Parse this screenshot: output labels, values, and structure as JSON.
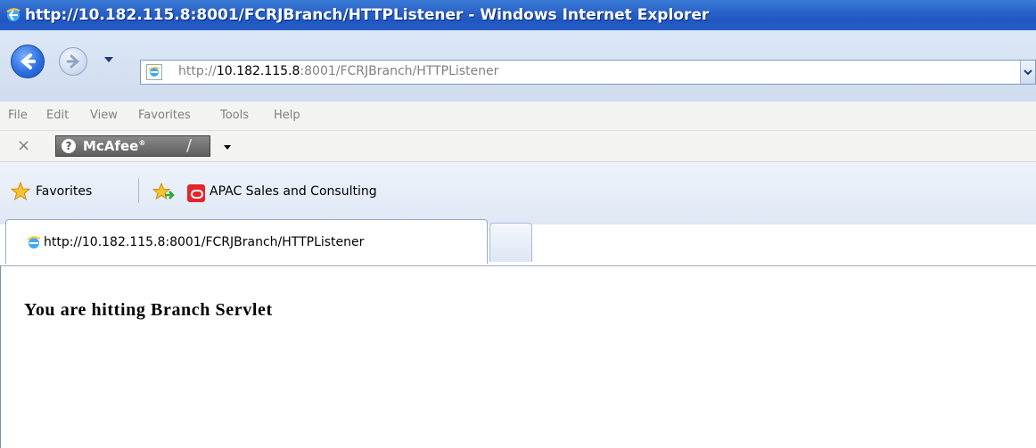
{
  "window": {
    "title": "http://10.182.115.8:8001/FCRJBranch/HTTPListener - Windows Internet Explorer"
  },
  "address_bar": {
    "url_prefix": "http://",
    "url_host": "10.182.115.8",
    "url_rest": ":8001/FCRJBranch/HTTPListener"
  },
  "menu": {
    "items": [
      {
        "label": "File"
      },
      {
        "label": "Edit"
      },
      {
        "label": "View"
      },
      {
        "label": "Favorites"
      },
      {
        "label": "Tools"
      },
      {
        "label": "Help"
      }
    ]
  },
  "mcafee_toolbar": {
    "close_label": "×",
    "brand_label": "McAfee",
    "trademark": "®"
  },
  "favorites_bar": {
    "favorites_label": "Favorites",
    "items": [
      {
        "label": "APAC Sales and Consulting"
      }
    ]
  },
  "tabs": [
    {
      "title": "http://10.182.115.8:8001/FCRJBranch/HTTPListener"
    }
  ],
  "page": {
    "message": "You are hitting Branch Servlet"
  },
  "colors": {
    "titlebar": "#2a63c8",
    "oracle_brand": "#e3262b",
    "mcafee_badge": "#6e6e6e"
  }
}
